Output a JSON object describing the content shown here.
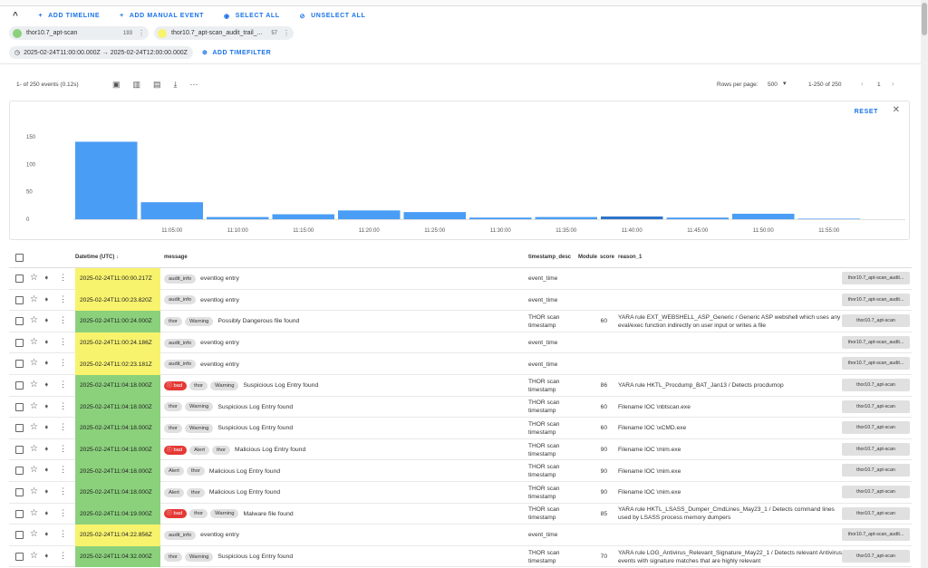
{
  "toolbar": {
    "add_timeline": "ADD TIMELINE",
    "add_manual_event": "ADD MANUAL EVENT",
    "select_all": "SELECT ALL",
    "unselect_all": "UNSELECT ALL"
  },
  "timelines": [
    {
      "name": "thor10.7_apt-scan",
      "count": "193",
      "color": "#8bd17c"
    },
    {
      "name": "thor10.7_apt-scan_audit_trail_...",
      "count": "57",
      "color": "#f7f36d"
    }
  ],
  "timefilter": {
    "range": "2025-02-24T11:00:00.000Z → 2025-02-24T12:00:00.000Z",
    "add_label": "ADD TIMEFILTER"
  },
  "listbar": {
    "event_count": "1- of 250 events (0.12s)",
    "rows_per_page_label": "Rows per page:",
    "rows_per_page": "500",
    "range": "1-250 of 250",
    "page": "1"
  },
  "histogram": {
    "reset": "RESET"
  },
  "chart_data": {
    "type": "bar",
    "categories": [
      "11:00",
      "11:05",
      "11:10",
      "11:15",
      "11:20",
      "11:25",
      "11:30",
      "11:35",
      "11:40",
      "11:45",
      "11:50",
      "11:55"
    ],
    "values": [
      141,
      31,
      4,
      9,
      16,
      13,
      3,
      4,
      5,
      3,
      10,
      1
    ],
    "x_tick_labels": [
      "11:05:00",
      "11:10:00",
      "11:15:00",
      "11:20:00",
      "11:25:00",
      "11:30:00",
      "11:35:00",
      "11:40:00",
      "11:45:00",
      "11:50:00",
      "11:55:00"
    ],
    "y_ticks": [
      0,
      50,
      100,
      150
    ],
    "ylim": [
      0,
      150
    ],
    "bar_color": "#4a9df5",
    "highlight_color": "#2f74c8",
    "highlight_index": 8
  },
  "table": {
    "headers": {
      "datetime": "Datetime (UTC)",
      "message": "message",
      "timestamp_desc": "timestamp_desc",
      "module": "Module",
      "score": "score",
      "reason": "reason_1"
    },
    "rows": [
      {
        "datetime": "2025-02-24T11:00:00.217Z",
        "color": "#f7f36d",
        "labels": [
          "audit_info"
        ],
        "message": "eventlog entry",
        "tsd1": "event_time",
        "tsd2": "",
        "score": "",
        "reason": "",
        "timeline": "thor10.7_apt-scan_audit..."
      },
      {
        "datetime": "2025-02-24T11:00:23.820Z",
        "color": "#f7f36d",
        "labels": [
          "audit_info"
        ],
        "message": "eventlog entry",
        "tsd1": "event_time",
        "tsd2": "",
        "score": "",
        "reason": "",
        "timeline": "thor10.7_apt-scan_audit..."
      },
      {
        "datetime": "2025-02-24T11:00:24.000Z",
        "color": "#8bd17c",
        "labels": [
          "thor",
          "Warning"
        ],
        "message": "Possibly Dangerous file found",
        "tsd1": "THOR scan",
        "tsd2": "timestamp",
        "score": "60",
        "reason": "YARA rule EXT_WEBSHELL_ASP_Generic / Generic ASP webshell which uses any eval/exec function indirectly on user input or writes a file",
        "timeline": "thor10.7_apt-scan"
      },
      {
        "datetime": "2025-02-24T11:00:24.186Z",
        "color": "#f7f36d",
        "labels": [
          "audit_info"
        ],
        "message": "eventlog entry",
        "tsd1": "event_time",
        "tsd2": "",
        "score": "",
        "reason": "",
        "timeline": "thor10.7_apt-scan_audit..."
      },
      {
        "datetime": "2025-02-24T11:02:23.181Z",
        "color": "#f7f36d",
        "labels": [
          "audit_info"
        ],
        "message": "eventlog entry",
        "tsd1": "event_time",
        "tsd2": "",
        "score": "",
        "reason": "",
        "timeline": "thor10.7_apt-scan_audit..."
      },
      {
        "datetime": "2025-02-24T11:04:18.000Z",
        "color": "#8bd17c",
        "bad": "bad",
        "labels": [
          "thor",
          "Warning"
        ],
        "message": "Suspicious Log Entry found",
        "tsd1": "THOR scan",
        "tsd2": "timestamp",
        "score": "86",
        "reason": "YARA rule HKTL_Procdump_BAT_Jan13 / Detects procdumop",
        "timeline": "thor10.7_apt-scan"
      },
      {
        "datetime": "2025-02-24T11:04:18.000Z",
        "color": "#8bd17c",
        "labels": [
          "thor",
          "Warning"
        ],
        "message": "Suspicious Log Entry found",
        "tsd1": "THOR scan",
        "tsd2": "timestamp",
        "score": "60",
        "reason": "Filename IOC \\nbtscan.exe",
        "timeline": "thor10.7_apt-scan"
      },
      {
        "datetime": "2025-02-24T11:04:18.000Z",
        "color": "#8bd17c",
        "labels": [
          "thor",
          "Warning"
        ],
        "message": "Suspicious Log Entry found",
        "tsd1": "THOR scan",
        "tsd2": "timestamp",
        "score": "60",
        "reason": "Filename IOC \\xCMD.exe",
        "timeline": "thor10.7_apt-scan"
      },
      {
        "datetime": "2025-02-24T11:04:18.000Z",
        "color": "#8bd17c",
        "bad": "bad",
        "labels": [
          "Alert",
          "thor"
        ],
        "message": "Malicious Log Entry found",
        "tsd1": "THOR scan",
        "tsd2": "timestamp",
        "score": "90",
        "reason": "Filename IOC \\mim.exe",
        "timeline": "thor10.7_apt-scan"
      },
      {
        "datetime": "2025-02-24T11:04:18.000Z",
        "color": "#8bd17c",
        "labels": [
          "Alert",
          "thor"
        ],
        "message": "Malicious Log Entry found",
        "tsd1": "THOR scan",
        "tsd2": "timestamp",
        "score": "90",
        "reason": "Filename IOC \\mim.exe",
        "timeline": "thor10.7_apt-scan"
      },
      {
        "datetime": "2025-02-24T11:04:18.000Z",
        "color": "#8bd17c",
        "labels": [
          "Alert",
          "thor"
        ],
        "message": "Malicious Log Entry found",
        "tsd1": "THOR scan",
        "tsd2": "timestamp",
        "score": "90",
        "reason": "Filename IOC \\mim.exe",
        "timeline": "thor10.7_apt-scan"
      },
      {
        "datetime": "2025-02-24T11:04:19.000Z",
        "color": "#8bd17c",
        "bad": "bad",
        "labels": [
          "thor",
          "Warning"
        ],
        "message": "Malware file found",
        "tsd1": "THOR scan",
        "tsd2": "timestamp",
        "score": "85",
        "reason": "YARA rule HKTL_LSASS_Dumper_CmdLines_May23_1 / Detects command lines used by LSASS process memory dumpers",
        "timeline": "thor10.7_apt-scan"
      },
      {
        "datetime": "2025-02-24T11:04:22.856Z",
        "color": "#f7f36d",
        "labels": [
          "audit_info"
        ],
        "message": "eventlog entry",
        "tsd1": "event_time",
        "tsd2": "",
        "score": "",
        "reason": "",
        "timeline": "thor10.7_apt-scan_audit..."
      },
      {
        "datetime": "2025-02-24T11:04:32.000Z",
        "color": "#8bd17c",
        "labels": [
          "thor",
          "Warning"
        ],
        "message": "Suspicious Log Entry found",
        "tsd1": "THOR scan",
        "tsd2": "timestamp",
        "score": "70",
        "reason": "YARA rule LOG_Antivirus_Relevant_Signature_May22_1 / Detects relevant Antivirus events with signature matches that are highly relevant",
        "timeline": "thor10.7_apt-scan"
      }
    ]
  }
}
